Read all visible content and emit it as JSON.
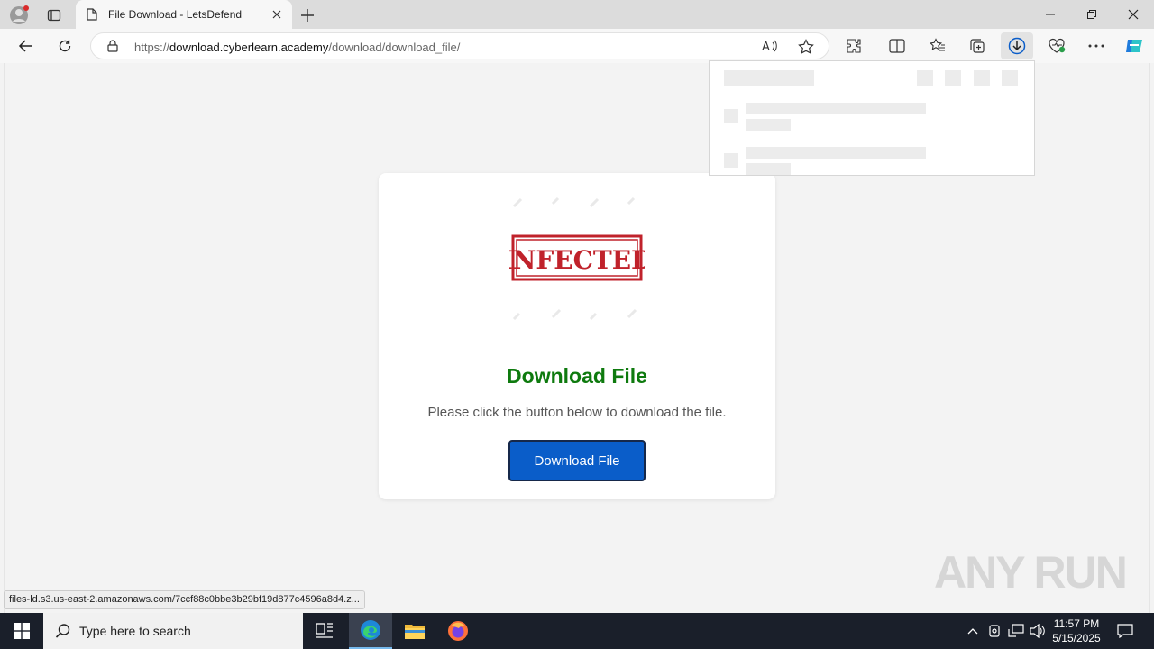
{
  "browser": {
    "tab_title": "File Download - LetsDefend",
    "url_prefix": "https://",
    "url_host": "download.cyberlearn.academy",
    "url_path": "/download/download_file/",
    "status_url": "files-ld.s3.us-east-2.amazonaws.com/7ccf88c0bbe3b29bf19d877c4596a8d4.z..."
  },
  "page": {
    "stamp_text": "INFECTED",
    "title": "Download File",
    "description": "Please click the button below to download the file.",
    "button_label": "Download File"
  },
  "watermark": "ANY RUN",
  "taskbar": {
    "search_placeholder": "Type here to search",
    "time": "11:57 PM",
    "date": "5/15/2025"
  },
  "colors": {
    "accent": "#0a5dc9",
    "title_green": "#0e7a0e",
    "stamp_red": "#c0222b"
  }
}
